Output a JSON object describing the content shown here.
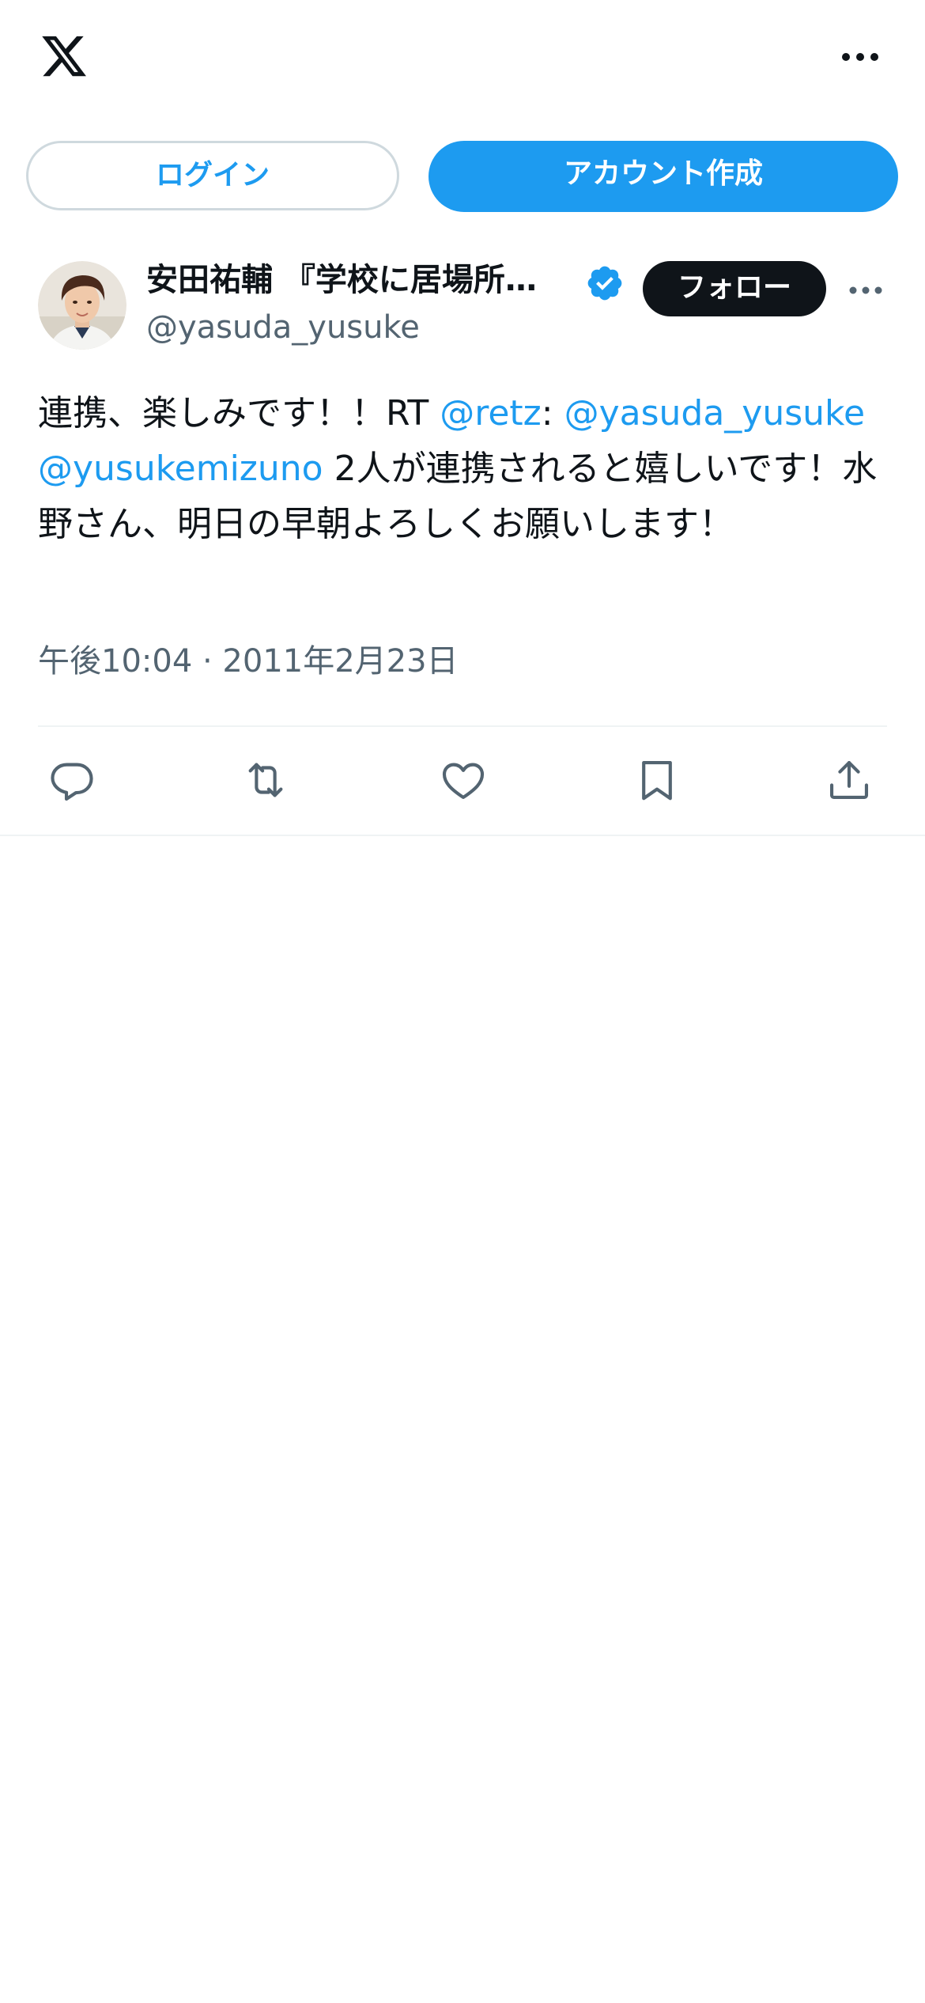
{
  "header": {
    "logo_icon": "x-logo-icon",
    "more_icon": "more-horizontal-icon"
  },
  "auth": {
    "login_label": "ログイン",
    "signup_label": "アカウント作成"
  },
  "tweet": {
    "author": {
      "display_name": "安田祐輔 『学校に居場所がないあなたへ』",
      "handle": "@yasuda_yusuke",
      "verified": true,
      "avatar_icon": "profile-photo"
    },
    "follow_label": "フォロー",
    "text": {
      "part1": "連携、楽しみです！！RT ",
      "mention1": "@retz",
      "part2": ": ",
      "mention2": "@yasuda_yusuke",
      "part3": " ",
      "mention3": "@yusukemizuno",
      "part4": " 2人が連携されると嬉しいです！水野さん、明日の早朝よろしくお願いします！"
    },
    "timestamp": "午後10:04 · 2011年2月23日",
    "actions": [
      "reply-icon",
      "retweet-icon",
      "like-icon",
      "bookmark-icon",
      "share-icon"
    ]
  },
  "colors": {
    "accent": "#1d9bf0",
    "text_primary": "#0f1419",
    "text_secondary": "#536471",
    "border": "#cfd9de",
    "divider": "#eff3f4"
  }
}
